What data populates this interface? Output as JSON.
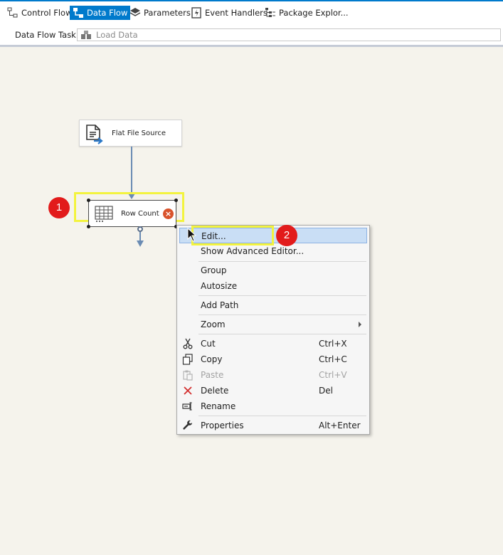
{
  "tabs": [
    {
      "label": "Control Flow",
      "icon": "control-flow-icon",
      "active": false
    },
    {
      "label": "Data Flow",
      "icon": "data-flow-icon",
      "active": true
    },
    {
      "label": "Parameters",
      "icon": "parameters-icon",
      "active": false
    },
    {
      "label": "Event Handlers",
      "icon": "event-handlers-icon",
      "active": false
    },
    {
      "label": "Package Explor...",
      "icon": "package-explorer-icon",
      "active": false
    }
  ],
  "task": {
    "label": "Data Flow Task:",
    "value": "Load Data"
  },
  "components": {
    "source": {
      "label": "Flat File Source"
    },
    "row_count": {
      "label": "Row Count",
      "status": "error-icon"
    }
  },
  "badges": [
    "1",
    "2"
  ],
  "context_menu": {
    "items": [
      {
        "label": "Edit...",
        "shortcut": "",
        "icon": "",
        "state": "hover"
      },
      {
        "label": "Show Advanced Editor...",
        "shortcut": "",
        "icon": "",
        "state": "normal"
      },
      {
        "label": "Group",
        "shortcut": "",
        "icon": "",
        "state": "normal"
      },
      {
        "label": "Autosize",
        "shortcut": "",
        "icon": "",
        "state": "normal"
      },
      {
        "label": "Add Path",
        "shortcut": "",
        "icon": "",
        "state": "normal"
      },
      {
        "label": "Zoom",
        "shortcut": "",
        "icon": "",
        "state": "submenu"
      },
      {
        "label": "Cut",
        "shortcut": "Ctrl+X",
        "icon": "scissors-icon",
        "state": "normal"
      },
      {
        "label": "Copy",
        "shortcut": "Ctrl+C",
        "icon": "copy-icon",
        "state": "normal"
      },
      {
        "label": "Paste",
        "shortcut": "Ctrl+V",
        "icon": "paste-icon",
        "state": "disabled"
      },
      {
        "label": "Delete",
        "shortcut": "Del",
        "icon": "delete-x-icon",
        "state": "normal"
      },
      {
        "label": "Rename",
        "shortcut": "",
        "icon": "rename-icon",
        "state": "normal"
      },
      {
        "label": "Properties",
        "shortcut": "Alt+Enter",
        "icon": "wrench-icon",
        "state": "normal"
      }
    ]
  },
  "colors": {
    "accent": "#007acc",
    "canvas": "#f5f3ec",
    "highlight": "#f3f33e",
    "badge": "#e21b1b",
    "menu_hover": "#c9def5"
  }
}
